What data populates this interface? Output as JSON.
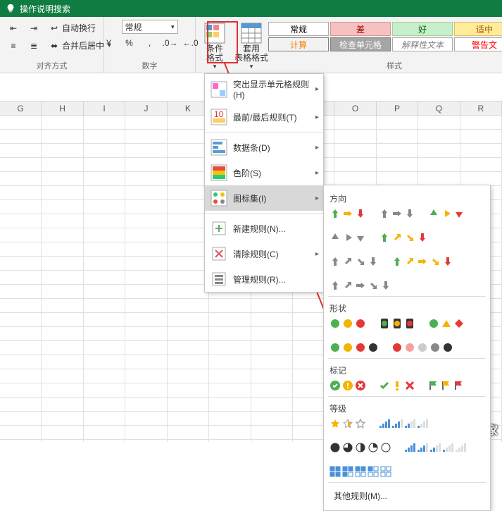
{
  "titlebar": {
    "search": "操作说明搜索"
  },
  "ribbon": {
    "align": {
      "wrap": "自动换行",
      "merge": "合并后居中",
      "label": "对齐方式"
    },
    "number": {
      "format": "常规",
      "label": "数字"
    },
    "cond": {
      "label": "条件格式",
      "table": "套用\n表格格式"
    },
    "styles": {
      "label": "样式",
      "items": [
        {
          "t": "常规",
          "bg": "#ffffff",
          "fg": "#000000",
          "bd": "#ababab"
        },
        {
          "t": "差",
          "bg": "#f6c1c0",
          "fg": "#9c0006",
          "bd": "#d99694"
        },
        {
          "t": "好",
          "bg": "#c6efce",
          "fg": "#006100",
          "bd": "#a8d08d"
        },
        {
          "t": "适中",
          "bg": "#ffeb9c",
          "fg": "#9c5700",
          "bd": "#e2c06b"
        },
        {
          "t": "计算",
          "bg": "#f2f2f2",
          "fg": "#fa7d00",
          "bd": "#7f7f7f"
        },
        {
          "t": "检查单元格",
          "bg": "#a5a5a5",
          "fg": "#ffffff",
          "bd": "#7f7f7f"
        },
        {
          "t": "解释性文本",
          "bg": "#ffffff",
          "fg": "#7f7f7f",
          "bd": "#ababab",
          "it": true
        },
        {
          "t": "警告文",
          "bg": "#ffffff",
          "fg": "#ff0000",
          "bd": "#ababab"
        }
      ]
    }
  },
  "cols": [
    "G",
    "H",
    "I",
    "J",
    "K",
    "",
    "",
    "",
    "O",
    "P",
    "Q",
    "R"
  ],
  "menu1": {
    "hl": "突出显示单元格规则(H)",
    "top": "最前/最后规则(T)",
    "bars": "数据条(D)",
    "scales": "色阶(S)",
    "icons": "图标集(I)",
    "new": "新建规则(N)...",
    "clear": "清除规则(C)",
    "manage": "管理规则(R)..."
  },
  "menu2": {
    "dir": "方向",
    "shape": "形状",
    "mark": "标记",
    "rank": "等级",
    "more": "其他规则(M)..."
  },
  "watermark": "系统之家"
}
